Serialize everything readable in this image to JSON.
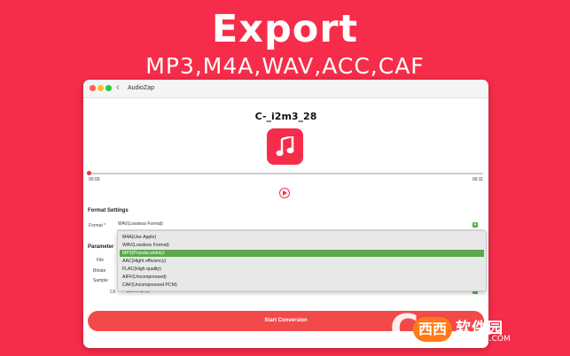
{
  "promo": {
    "title": "Export",
    "subtitle": "MP3,M4A,WAV,ACC,CAF"
  },
  "window": {
    "title": "AudioZap",
    "back_icon": "chevron-left-icon"
  },
  "player": {
    "track_title": "C-_i2m3_28",
    "music_icon": "music-note-icon",
    "time_start": "00:00",
    "time_end": "00:11",
    "progress": 0.0,
    "play_icon": "play-circle-icon"
  },
  "format_settings": {
    "section_title": "Format Settings",
    "format_label": "Format *",
    "format_value": "WAV(Lossless Format)",
    "options": [
      "M4A(Like Apple)",
      "WAV(Lossless Format)",
      "MP3(Popular,widely)",
      "AAC(Hight efficiency)",
      "FLAC(High quality)",
      "AIFF(Uncompressed)",
      "CAF(Uncompressed PCM)"
    ],
    "highlighted_index": 2
  },
  "parameters": {
    "section_title": "Parameter",
    "file_label": "File",
    "bitrate_label": "Bitrate",
    "sample_label": "Sample",
    "channel_label": "Ch",
    "channel_value": "Stereo (2.0)"
  },
  "actions": {
    "start_label": "Start Conversion"
  },
  "watermark": {
    "bubble": "西西",
    "name": "软件园",
    "domain": "CR173.COM"
  },
  "colors": {
    "brand": "#f52d4a",
    "accent_green": "#5ba84a",
    "button_red": "#f24a4a"
  }
}
